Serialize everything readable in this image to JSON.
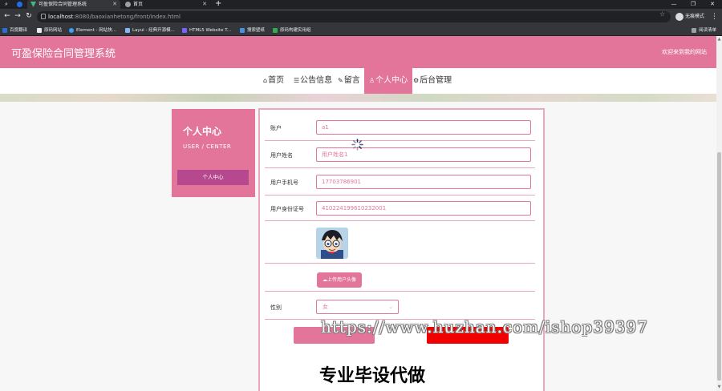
{
  "browser": {
    "tabs": [
      {
        "label": "可盈保险合同管理系统",
        "active": true
      },
      {
        "label": "首页",
        "active": false
      }
    ],
    "url_host": "localhost",
    "url_path": ":8080/baoxianhetong/front/index.html",
    "profile_label": "无痕模式",
    "bookmarks": [
      "百度翻译",
      "原码网站",
      "Element - 网站快...",
      "Layui - 经典开源模...",
      "HTML5 Website T...",
      "搜索壁纸",
      "原码构建实用组"
    ],
    "reading_list": "阅读清单"
  },
  "site": {
    "title": "可盈保险合同管理系统",
    "welcome": "欢迎来到我的网站",
    "nav": [
      {
        "icon": "⌂",
        "label": "首页"
      },
      {
        "icon": "☰",
        "label": "公告信息"
      },
      {
        "icon": "✎",
        "label": "留言"
      },
      {
        "icon": "♙",
        "label": "个人中心"
      },
      {
        "icon": "⚙",
        "label": "后台管理"
      }
    ]
  },
  "sidebar": {
    "title": "个人中心",
    "subtitle": "USER / CENTER",
    "items": [
      "个人中心"
    ]
  },
  "form": {
    "account_label": "账户",
    "account_value": "a1",
    "name_label": "用户姓名",
    "name_value": "用户姓名1",
    "phone_label": "用户手机号",
    "phone_value": "17703786901",
    "idcard_label": "用户身份证号",
    "idcard_value": "410224199610232001",
    "upload_label": "上传用户头像",
    "gender_label": "性别",
    "gender_value": "女"
  },
  "overlay": {
    "watermark": "https://www.huzhan.com/ishop39397",
    "caption": "专业毕设代做"
  },
  "colors": {
    "accent": "#e27599",
    "sidebar_active": "#b5488e",
    "danger": "#f20000"
  }
}
